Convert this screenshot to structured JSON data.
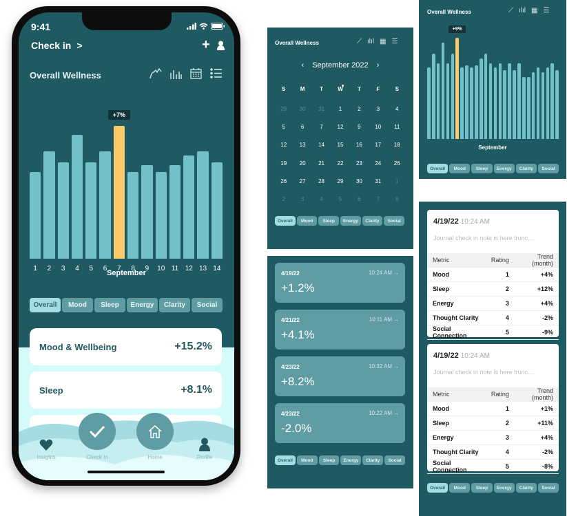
{
  "colors": {
    "background": "#1f5a62",
    "bar": "#72c1c9",
    "highlight": "#fcc96b",
    "tab": "#5f9ca3",
    "tab_active": "#a5dce1",
    "light": "#d4fbfb"
  },
  "phone": {
    "status": {
      "time": "9:41"
    },
    "header": {
      "checkin_label": "Check in",
      "chevron": ">"
    },
    "title": "Overall Wellness",
    "view_icons": [
      "line-chart-icon",
      "bar-chart-icon",
      "calendar-icon",
      "list-icon"
    ],
    "chart_data": {
      "type": "bar",
      "categories": [
        "1",
        "2",
        "3",
        "4",
        "5",
        "6",
        "7",
        "8",
        "9",
        "10",
        "11",
        "12",
        "13",
        "14"
      ],
      "values": [
        38,
        47,
        42,
        54,
        42,
        47,
        58,
        38,
        41,
        38,
        41,
        45,
        47,
        42
      ],
      "highlight_index": 6,
      "tooltip": "+7%",
      "xlabel": "September"
    },
    "tabs": [
      "Overall",
      "Mood",
      "Sleep",
      "Energy",
      "Clarity",
      "Social"
    ],
    "active_tab": 0,
    "cards": [
      {
        "label": "Mood & Wellbeing",
        "value": "+15.2%"
      },
      {
        "label": "Sleep",
        "value": "+8.1%"
      }
    ],
    "nav": {
      "insights": "Insights",
      "checkin": "Check In",
      "home": "Home",
      "profile": "Profile"
    }
  },
  "calendar_panel": {
    "title": "Overall Wellness",
    "month": "September 2022",
    "weekdays": [
      "S",
      "M",
      "T",
      "W",
      "T",
      "F",
      "S"
    ],
    "weeks": [
      [
        {
          "d": "29",
          "m": 1
        },
        {
          "d": "30",
          "m": 1
        },
        {
          "d": "31",
          "m": 1
        },
        {
          "d": "1"
        },
        {
          "d": "2"
        },
        {
          "d": "3"
        },
        {
          "d": "4"
        }
      ],
      [
        {
          "d": "5"
        },
        {
          "d": "6"
        },
        {
          "d": "7"
        },
        {
          "d": "12",
          "dot": 1
        },
        {
          "d": "9"
        },
        {
          "d": "10"
        },
        {
          "d": "11"
        }
      ],
      [
        {
          "d": "12"
        },
        {
          "d": "13"
        },
        {
          "d": "14"
        },
        {
          "d": "15"
        },
        {
          "d": "16"
        },
        {
          "d": "17"
        },
        {
          "d": "18"
        }
      ],
      [
        {
          "d": "19"
        },
        {
          "d": "20"
        },
        {
          "d": "21"
        },
        {
          "d": "22"
        },
        {
          "d": "23"
        },
        {
          "d": "24"
        },
        {
          "d": "26"
        }
      ],
      [
        {
          "d": "26"
        },
        {
          "d": "27"
        },
        {
          "d": "28"
        },
        {
          "d": "29"
        },
        {
          "d": "30"
        },
        {
          "d": "31"
        },
        {
          "d": "1",
          "m": 1
        }
      ],
      [
        {
          "d": "2",
          "m": 1
        },
        {
          "d": "3",
          "m": 1
        },
        {
          "d": "4",
          "m": 1
        },
        {
          "d": "5",
          "m": 1
        },
        {
          "d": "6",
          "m": 1
        },
        {
          "d": "7",
          "m": 1
        },
        {
          "d": "8",
          "m": 1
        }
      ]
    ],
    "tabs": [
      "Overall",
      "Mood",
      "Sleep",
      "Energy",
      "Clarity",
      "Social"
    ]
  },
  "list_panel": {
    "entries": [
      {
        "date": "4/19/22",
        "time": "10:24 AM",
        "value": "+1.2%"
      },
      {
        "date": "4/21/22",
        "time": "10:11 AM",
        "value": "+4.1%"
      },
      {
        "date": "4/23/22",
        "time": "10:32 AM",
        "value": "+8.2%"
      },
      {
        "date": "4/23/22",
        "time": "10:22 AM",
        "value": "-2.0%"
      }
    ],
    "arrow": "→",
    "tabs": [
      "Overall",
      "Mood",
      "Sleep",
      "Energy",
      "Clarity",
      "Social"
    ]
  },
  "month_panel": {
    "title": "Overall Wellness",
    "chart_data": {
      "type": "bar",
      "values": [
        31,
        37,
        33,
        42,
        33,
        37,
        44,
        31,
        32,
        31,
        32,
        35,
        37,
        33,
        31,
        33,
        30,
        33,
        30,
        33,
        27,
        27,
        29,
        31,
        29,
        31,
        33,
        30
      ],
      "highlight_index": 6,
      "tooltip": "+9%",
      "xlabel": "September"
    },
    "tabs": [
      "Overall",
      "Mood",
      "Sleep",
      "Energy",
      "Clarity",
      "Social"
    ]
  },
  "journal_panel": {
    "columns": [
      "Metric",
      "Rating",
      "Trend (month)"
    ],
    "entries": [
      {
        "date": "4/19/22",
        "time": "10:24 AM",
        "note": "Journal check in note is here trunc....",
        "rows": [
          [
            "Mood",
            "1",
            "+4%"
          ],
          [
            "Sleep",
            "2",
            "+12%"
          ],
          [
            "Energy",
            "3",
            "+4%"
          ],
          [
            "Thought Clarity",
            "4",
            "-2%"
          ],
          [
            "Social Connection",
            "5",
            "-9%"
          ]
        ]
      },
      {
        "date": "4/19/22",
        "time": "10:24 AM",
        "note": "Journal check in note is here trunc....",
        "rows": [
          [
            "Mood",
            "1",
            "+1%"
          ],
          [
            "Sleep",
            "2",
            "+11%"
          ],
          [
            "Energy",
            "3",
            "+4%"
          ],
          [
            "Thought Clarity",
            "4",
            "-2%"
          ],
          [
            "Social Connection",
            "5",
            "-8%"
          ]
        ]
      }
    ],
    "tabs": [
      "Overall",
      "Mood",
      "Sleep",
      "Energy",
      "Clarity",
      "Social"
    ]
  }
}
